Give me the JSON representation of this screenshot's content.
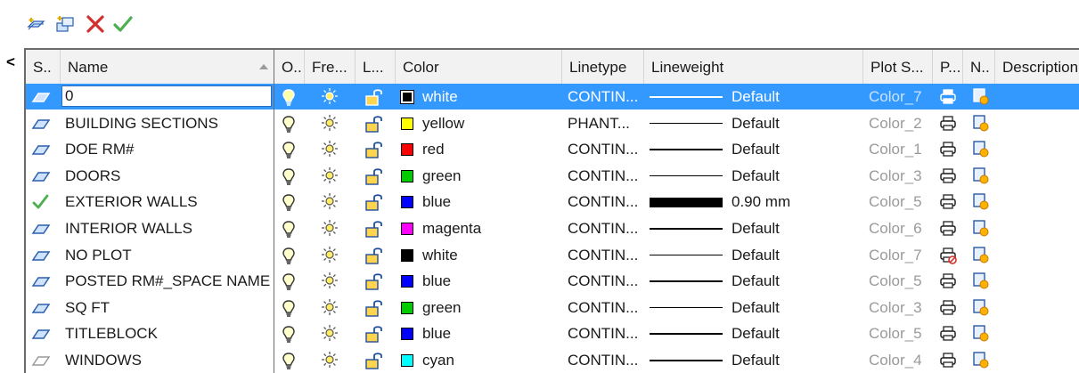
{
  "toolbar": {
    "buttons": [
      {
        "name": "new-layer-button",
        "icon": "new-layer-icon"
      },
      {
        "name": "new-layer-vp-frozen-button",
        "icon": "new-layer-frozen-icon"
      },
      {
        "name": "delete-layer-button",
        "icon": "delete-icon"
      },
      {
        "name": "set-current-button",
        "icon": "checkmark-icon"
      }
    ]
  },
  "sidebar": {
    "collapse_glyph": "<"
  },
  "columns": {
    "status": "S..",
    "name": "Name",
    "on": "O..",
    "freeze": "Fre...",
    "lock": "L...",
    "color": "Color",
    "linetype": "Linetype",
    "lineweight": "Lineweight",
    "plot_style": "Plot S...",
    "plot": "P...",
    "new_vp_freeze": "N..",
    "description": "Description"
  },
  "rows": [
    {
      "name": "0",
      "color": "white",
      "color_hex": "#000000",
      "linetype": "CONTIN...",
      "lineweight": "Default",
      "plot_style": "Color_7",
      "selected": true,
      "status": "layer",
      "plot": "printer"
    },
    {
      "name": "BUILDING SECTIONS",
      "color": "yellow",
      "color_hex": "#ffff00",
      "linetype": "PHANT...",
      "lineweight": "Default",
      "plot_style": "Color_2",
      "status": "layer",
      "plot": "printer"
    },
    {
      "name": "DOE RM#",
      "color": "red",
      "color_hex": "#ff0000",
      "linetype": "CONTIN...",
      "lineweight": "Default",
      "plot_style": "Color_1",
      "status": "layer",
      "plot": "printer"
    },
    {
      "name": "DOORS",
      "color": "green",
      "color_hex": "#00cc00",
      "linetype": "CONTIN...",
      "lineweight": "Default",
      "plot_style": "Color_3",
      "status": "layer",
      "plot": "printer"
    },
    {
      "name": "EXTERIOR WALLS",
      "color": "blue",
      "color_hex": "#0000ff",
      "linetype": "CONTIN...",
      "lineweight": "0.90 mm",
      "plot_style": "Color_5",
      "status": "current",
      "plot": "printer",
      "thick": true
    },
    {
      "name": "INTERIOR WALLS",
      "color": "magenta",
      "color_hex": "#ff00ff",
      "linetype": "CONTIN...",
      "lineweight": "Default",
      "plot_style": "Color_6",
      "status": "layer",
      "plot": "printer"
    },
    {
      "name": "NO PLOT",
      "color": "white",
      "color_hex": "#000000",
      "linetype": "CONTIN...",
      "lineweight": "Default",
      "plot_style": "Color_7",
      "status": "layer",
      "plot": "no-plot"
    },
    {
      "name": "POSTED RM#_SPACE NAME",
      "color": "blue",
      "color_hex": "#0000ff",
      "linetype": "CONTIN...",
      "lineweight": "Default",
      "plot_style": "Color_5",
      "status": "layer",
      "plot": "printer"
    },
    {
      "name": "SQ FT",
      "color": "green",
      "color_hex": "#00cc00",
      "linetype": "CONTIN...",
      "lineweight": "Default",
      "plot_style": "Color_3",
      "status": "layer",
      "plot": "printer"
    },
    {
      "name": "TITLEBLOCK",
      "color": "blue",
      "color_hex": "#0000ff",
      "linetype": "CONTIN...",
      "lineweight": "Default",
      "plot_style": "Color_5",
      "status": "layer",
      "plot": "printer"
    },
    {
      "name": "WINDOWS",
      "color": "cyan",
      "color_hex": "#00ffff",
      "linetype": "CONTIN...",
      "lineweight": "Default",
      "plot_style": "Color_4",
      "status": "layer-empty",
      "plot": "printer"
    }
  ],
  "colors": {
    "selection": "#3399ff",
    "status_current": "#4caf50"
  }
}
